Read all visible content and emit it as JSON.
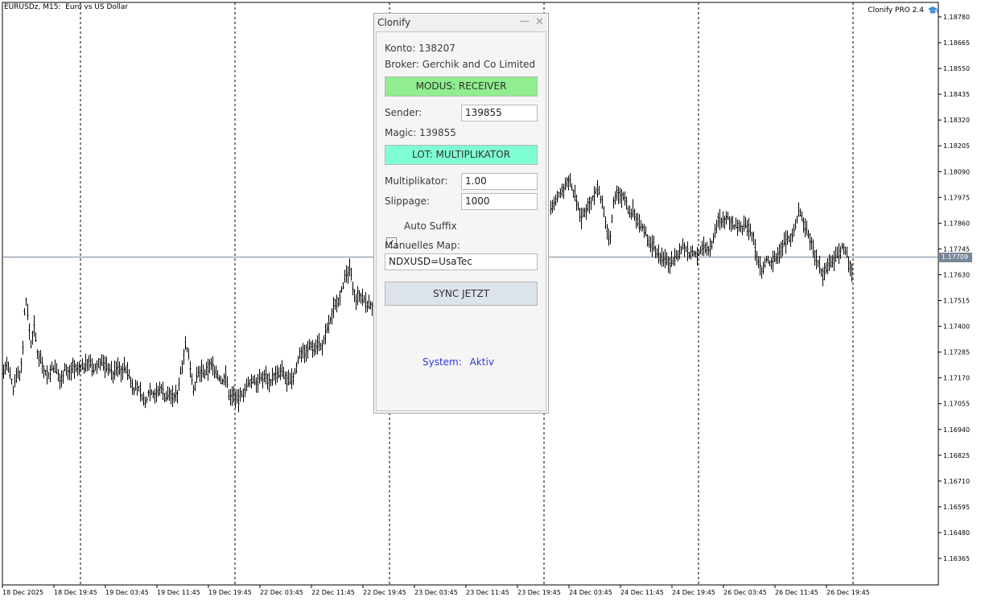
{
  "chart": {
    "symbol_title": "EURUSDz, M15:  Euro vs US Dollar",
    "ea_name": "Clonify PRO 2.4",
    "bid_tag": "1.17709",
    "bid_price": 1.17709,
    "price_range": [
      1.1629,
      1.1885
    ],
    "price_ticks": [
      "1.18780",
      "1.18665",
      "1.18550",
      "1.18435",
      "1.18320",
      "1.18205",
      "1.18090",
      "1.17975",
      "1.17860",
      "1.17745",
      "1.17630",
      "1.17515",
      "1.17400",
      "1.17285",
      "1.17170",
      "1.17055",
      "1.16940",
      "1.16825",
      "1.16710",
      "1.16595",
      "1.16480",
      "1.16365"
    ],
    "time_ticks": [
      "18 Dec 2025",
      "18 Dec 19:45",
      "19 Dec 03:45",
      "19 Dec 11:45",
      "19 Dec 19:45",
      "22 Dec 03:45",
      "22 Dec 11:45",
      "22 Dec 19:45",
      "23 Dec 03:45",
      "23 Dec 11:45",
      "23 Dec 19:45",
      "24 Dec 03:45",
      "24 Dec 11:45",
      "24 Dec 19:45",
      "26 Dec 03:45",
      "26 Dec 11:45",
      "26 Dec 19:45"
    ],
    "close_path": [
      [
        0,
        1.1722
      ],
      [
        4,
        1.172
      ],
      [
        8,
        1.1723
      ],
      [
        12,
        1.1718
      ],
      [
        16,
        1.1712
      ],
      [
        20,
        1.172
      ],
      [
        24,
        1.1718
      ],
      [
        28,
        1.173
      ],
      [
        31,
        1.1755
      ],
      [
        34,
        1.1745
      ],
      [
        38,
        1.1732
      ],
      [
        42,
        1.174
      ],
      [
        46,
        1.1728
      ],
      [
        50,
        1.1726
      ],
      [
        55,
        1.172
      ],
      [
        60,
        1.1718
      ],
      [
        65,
        1.1722
      ],
      [
        70,
        1.172
      ],
      [
        75,
        1.1715
      ],
      [
        80,
        1.1722
      ],
      [
        85,
        1.1718
      ],
      [
        90,
        1.1723
      ],
      [
        95,
        1.172
      ],
      [
        100,
        1.1722
      ],
      [
        105,
        1.1722
      ],
      [
        110,
        1.1725
      ],
      [
        115,
        1.172
      ],
      [
        120,
        1.1722
      ],
      [
        125,
        1.1725
      ],
      [
        130,
        1.1722
      ],
      [
        135,
        1.1722
      ],
      [
        140,
        1.1718
      ],
      [
        145,
        1.1722
      ],
      [
        150,
        1.172
      ],
      [
        155,
        1.1722
      ],
      [
        160,
        1.1718
      ],
      [
        165,
        1.1712
      ],
      [
        170,
        1.1713
      ],
      [
        175,
        1.171
      ],
      [
        180,
        1.1705
      ],
      [
        185,
        1.1712
      ],
      [
        190,
        1.171
      ],
      [
        195,
        1.171
      ],
      [
        200,
        1.1713
      ],
      [
        205,
        1.1708
      ],
      [
        210,
        1.171
      ],
      [
        215,
        1.1708
      ],
      [
        220,
        1.171
      ],
      [
        225,
        1.1722
      ],
      [
        230,
        1.1732
      ],
      [
        235,
        1.1725
      ],
      [
        240,
        1.1712
      ],
      [
        245,
        1.1718
      ],
      [
        250,
        1.172
      ],
      [
        255,
        1.1718
      ],
      [
        260,
        1.1723
      ],
      [
        265,
        1.1722
      ],
      [
        270,
        1.1718
      ],
      [
        275,
        1.1715
      ],
      [
        280,
        1.1718
      ],
      [
        285,
        1.1708
      ],
      [
        290,
        1.171
      ],
      [
        295,
        1.1706
      ],
      [
        300,
        1.171
      ],
      [
        305,
        1.1712
      ],
      [
        310,
        1.1715
      ],
      [
        315,
        1.1716
      ],
      [
        320,
        1.1715
      ],
      [
        325,
        1.1717
      ],
      [
        330,
        1.1718
      ],
      [
        335,
        1.1715
      ],
      [
        340,
        1.1718
      ],
      [
        345,
        1.1718
      ],
      [
        350,
        1.172
      ],
      [
        355,
        1.1716
      ],
      [
        360,
        1.1715
      ],
      [
        365,
        1.1718
      ],
      [
        370,
        1.1725
      ],
      [
        375,
        1.173
      ],
      [
        380,
        1.1728
      ],
      [
        385,
        1.1732
      ],
      [
        390,
        1.173
      ],
      [
        395,
        1.1733
      ],
      [
        400,
        1.173
      ],
      [
        405,
        1.1738
      ],
      [
        410,
        1.1742
      ],
      [
        415,
        1.175
      ],
      [
        420,
        1.1752
      ],
      [
        425,
        1.1758
      ],
      [
        430,
        1.1762
      ],
      [
        434,
        1.1765
      ],
      [
        438,
        1.1758
      ],
      [
        442,
        1.1752
      ],
      [
        446,
        1.1755
      ],
      [
        450,
        1.1752
      ],
      [
        455,
        1.175
      ],
      [
        462,
        1.1749
      ]
    ],
    "close_path_right": [
      [
        684,
        1.1793
      ],
      [
        690,
        1.1795
      ],
      [
        696,
        1.18
      ],
      [
        702,
        1.1803
      ],
      [
        707,
        1.1806
      ],
      [
        712,
        1.18
      ],
      [
        717,
        1.1795
      ],
      [
        722,
        1.1788
      ],
      [
        727,
        1.1792
      ],
      [
        732,
        1.1795
      ],
      [
        737,
        1.1798
      ],
      [
        742,
        1.1802
      ],
      [
        747,
        1.1796
      ],
      [
        752,
        1.1786
      ],
      [
        757,
        1.1778
      ],
      [
        762,
        1.1795
      ],
      [
        767,
        1.18
      ],
      [
        772,
        1.1798
      ],
      [
        777,
        1.1796
      ],
      [
        782,
        1.179
      ],
      [
        787,
        1.1792
      ],
      [
        792,
        1.1786
      ],
      [
        797,
        1.1784
      ],
      [
        802,
        1.1782
      ],
      [
        807,
        1.1776
      ],
      [
        812,
        1.1776
      ],
      [
        817,
        1.1772
      ],
      [
        822,
        1.177
      ],
      [
        827,
        1.177
      ],
      [
        832,
        1.1768
      ],
      [
        837,
        1.177
      ],
      [
        842,
        1.1772
      ],
      [
        847,
        1.1776
      ],
      [
        852,
        1.1774
      ],
      [
        857,
        1.1772
      ],
      [
        862,
        1.1773
      ],
      [
        867,
        1.1772
      ],
      [
        872,
        1.1776
      ],
      [
        877,
        1.1774
      ],
      [
        882,
        1.1775
      ],
      [
        887,
        1.178
      ],
      [
        892,
        1.1788
      ],
      [
        897,
        1.1786
      ],
      [
        902,
        1.1789
      ],
      [
        907,
        1.1788
      ],
      [
        912,
        1.1784
      ],
      [
        917,
        1.1786
      ],
      [
        922,
        1.1784
      ],
      [
        927,
        1.1785
      ],
      [
        932,
        1.1782
      ],
      [
        937,
        1.1776
      ],
      [
        942,
        1.1768
      ],
      [
        947,
        1.1765
      ],
      [
        952,
        1.177
      ],
      [
        957,
        1.1768
      ],
      [
        962,
        1.177
      ],
      [
        967,
        1.1772
      ],
      [
        972,
        1.1776
      ],
      [
        977,
        1.1778
      ],
      [
        982,
        1.178
      ],
      [
        987,
        1.1782
      ],
      [
        992,
        1.1792
      ],
      [
        997,
        1.1788
      ],
      [
        1002,
        1.1782
      ],
      [
        1007,
        1.1778
      ],
      [
        1012,
        1.1772
      ],
      [
        1017,
        1.1768
      ],
      [
        1022,
        1.1762
      ],
      [
        1027,
        1.1766
      ],
      [
        1032,
        1.1768
      ],
      [
        1037,
        1.177
      ],
      [
        1042,
        1.1772
      ],
      [
        1047,
        1.1776
      ],
      [
        1052,
        1.1772
      ],
      [
        1057,
        1.1765
      ]
    ]
  },
  "panel": {
    "title": "Clonify",
    "minimize_glyph": "—",
    "close_glyph": "✕",
    "konto": "Konto: 138207",
    "broker": "Broker: Gerchik and Co Limited",
    "modus_button": "MODUS: RECEIVER",
    "sender_label": "Sender:",
    "sender_value": "139855",
    "magic": "Magic: 139855",
    "lot_button": "LOT: MULTIPLIKATOR",
    "multiplikator_label": "Multiplikator:",
    "multiplikator_value": "1.00",
    "slippage_label": "Slippage:",
    "slippage_value": "1000",
    "auto_suffix_label": "Auto Suffix",
    "auto_suffix_checked": true,
    "manual_map_label": "Manuelles Map:",
    "manual_map_value": "NDXUSD=UsaTec",
    "sync_button": "SYNC JETZT",
    "system_label": "System:",
    "system_value": "Aktiv",
    "colors": {
      "modus_bg": "#90ee90",
      "lot_bg": "#7fffd4",
      "sync_bg": "#dde3ea",
      "status_text": "#2d3ad4"
    }
  }
}
